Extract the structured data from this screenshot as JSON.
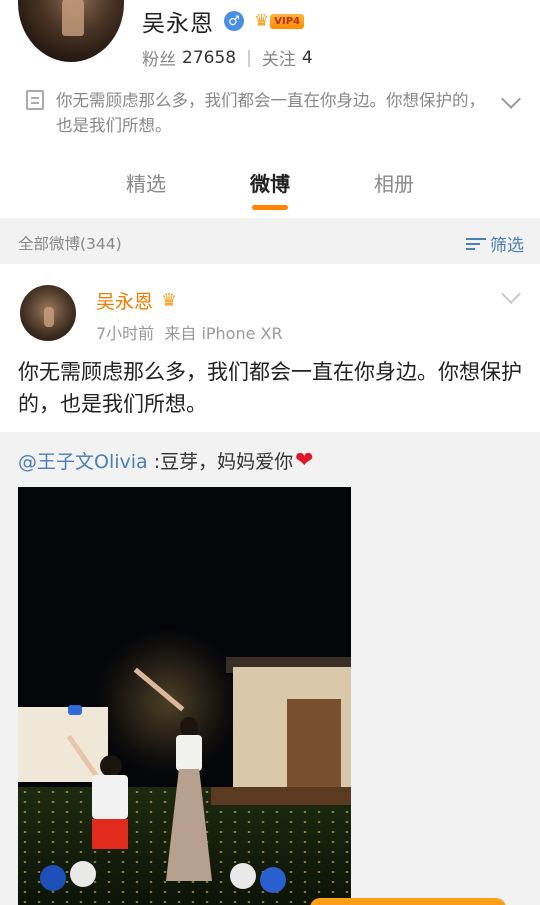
{
  "profile": {
    "name": "吴永恩",
    "gender_icon": "male-icon",
    "vip_label": "VIP4",
    "followers_label": "粉丝",
    "followers": "27658",
    "following_label": "关注",
    "following": "4",
    "bio": "你无需顾虑那么多，我们都会一直在你身边。你想保护的，也是我们所想。"
  },
  "tabs": [
    {
      "label": "精选",
      "active": false
    },
    {
      "label": "微博",
      "active": true
    },
    {
      "label": "相册",
      "active": false
    }
  ],
  "filter_bar": {
    "count_label": "全部微博(344)",
    "filter_label": "筛选"
  },
  "post": {
    "author": "吴永恩",
    "meta": "7小时前  来自 iPhone XR",
    "text": "你无需顾虑那么多，我们都会一直在你身边。你想保护的，也是我们所想。",
    "repost": {
      "mention": "@王子文Olivia",
      "text": " :豆芽，妈妈爱你",
      "emoji": "❤"
    }
  },
  "colors": {
    "accent": "#ff8200",
    "author_name": "#f07c00",
    "link": "#4a7fb5",
    "heart": "#e0162b"
  }
}
